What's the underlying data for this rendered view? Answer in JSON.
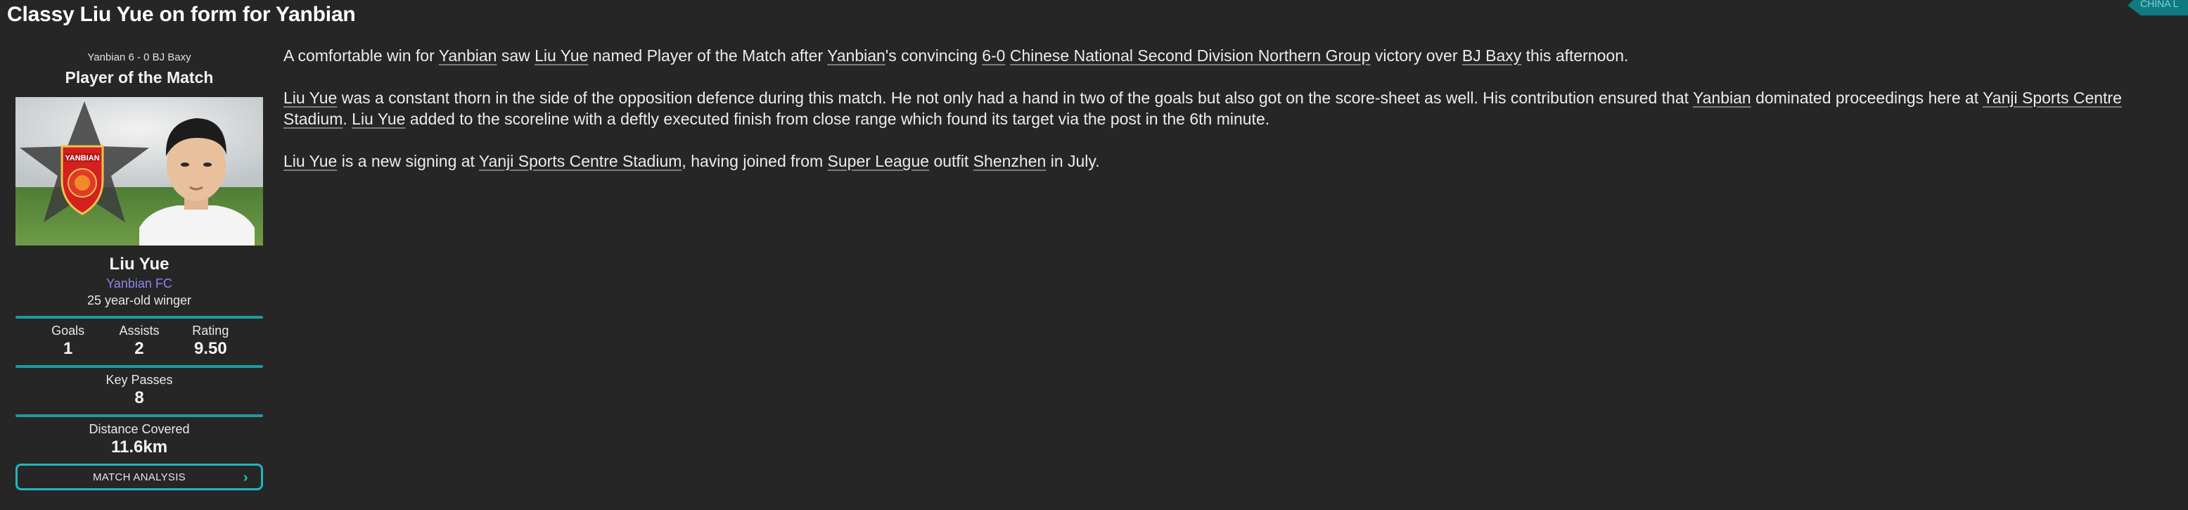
{
  "headline": "Classy Liu Yue on form for Yanbian",
  "competition_tag": "CHINA L",
  "sidebar": {
    "score_line": "Yanbian 6 - 0 BJ Baxy",
    "title": "Player of the Match",
    "badge_text": "YANBIAN",
    "player_name": "Liu Yue",
    "club": "Yanbian FC",
    "description": "25 year-old winger",
    "stats": [
      {
        "label": "Goals",
        "value": "1"
      },
      {
        "label": "Assists",
        "value": "2"
      },
      {
        "label": "Rating",
        "value": "9.50"
      }
    ],
    "key_passes": {
      "label": "Key Passes",
      "value": "8"
    },
    "distance": {
      "label": "Distance Covered",
      "value": "11.6km"
    },
    "button_label": "MATCH ANALYSIS",
    "button_chevron": "›"
  },
  "article": {
    "p1": {
      "t1": "A comfortable win for ",
      "l1": "Yanbian",
      "t2": " saw ",
      "l2": "Liu Yue",
      "t3": " named Player of the Match after ",
      "l3": "Yanbian",
      "t4": "'s convincing ",
      "l4": "6-0",
      "t5": " ",
      "l5": "Chinese National Second Division Northern Group",
      "t6": " victory over ",
      "l6": "BJ Baxy",
      "t7": " this afternoon."
    },
    "p2": {
      "l1": "Liu Yue",
      "t1": " was a constant thorn in the side of the opposition defence during this match. He not only had a hand in two of the goals but also got on the score-sheet as well. His contribution ensured that ",
      "l2": "Yanbian",
      "t2": " dominated proceedings here at ",
      "l3": "Yanji Sports Centre Stadium",
      "t3": ". ",
      "l4": "Liu Yue",
      "t4": " added to the scoreline with a deftly executed finish from close range which found its target via the post in the 6th minute."
    },
    "p3": {
      "l1": "Liu Yue",
      "t1": " is a new signing at ",
      "l2": "Yanji Sports Centre Stadium",
      "t2": ", having joined from ",
      "l3": "Super League",
      "t3": " outfit ",
      "l4": "Shenzhen",
      "t4": " in July."
    }
  },
  "colors": {
    "background": "#262626",
    "accent": "#1e9aa0",
    "club_link": "#8c86e8",
    "badge_red": "#d42020"
  },
  "icons": {
    "button_chevron": "chevron-right-icon",
    "club_badge": "club-badge-icon"
  }
}
